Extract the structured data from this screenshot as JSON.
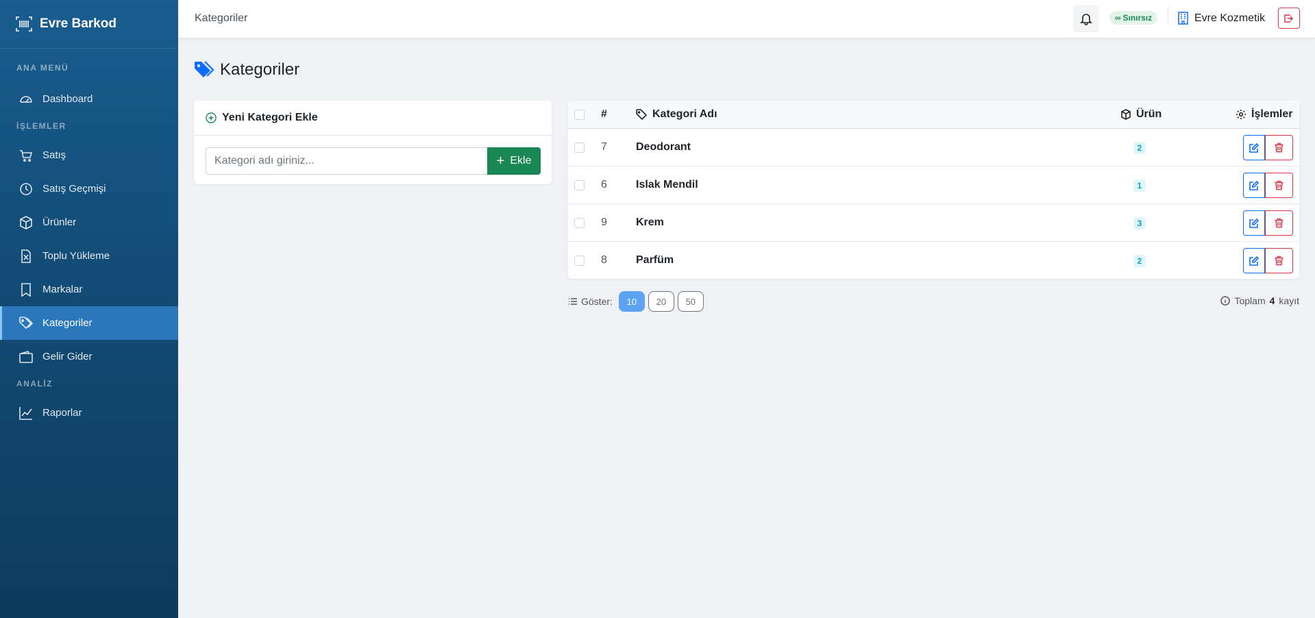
{
  "app": {
    "name": "Evre Barkod"
  },
  "sidebar": {
    "sections": [
      {
        "title": "ANA MENÜ"
      },
      {
        "title": "İŞLEMLER"
      },
      {
        "title": "ANALİZ"
      }
    ],
    "items": [
      {
        "label": "Dashboard",
        "icon": "speedometer-icon"
      },
      {
        "label": "Satış",
        "icon": "cart-icon"
      },
      {
        "label": "Satış Geçmişi",
        "icon": "clock-icon"
      },
      {
        "label": "Ürünler",
        "icon": "box-icon"
      },
      {
        "label": "Toplu Yükleme",
        "icon": "excel-file-icon"
      },
      {
        "label": "Markalar",
        "icon": "bookmark-icon"
      },
      {
        "label": "Kategoriler",
        "icon": "tags-icon",
        "active": true
      },
      {
        "label": "Gelir Gider",
        "icon": "wallet-icon"
      },
      {
        "label": "Raporlar",
        "icon": "chart-line-icon"
      }
    ]
  },
  "topbar": {
    "breadcrumb": "Kategoriler",
    "plan_badge": "Sınırsız",
    "company": "Evre Kozmetik"
  },
  "page": {
    "title": "Kategoriler"
  },
  "add_form": {
    "title": "Yeni Kategori Ekle",
    "input_placeholder": "Kategori adı giriniz...",
    "input_value": "",
    "button_label": "Ekle"
  },
  "table": {
    "columns": {
      "num": "#",
      "name": "Kategori Adı",
      "count": "Ürün",
      "actions": "İşlemler"
    },
    "rows": [
      {
        "id": "7",
        "name": "Deodorant",
        "count": "2"
      },
      {
        "id": "6",
        "name": "Islak Mendil",
        "count": "1"
      },
      {
        "id": "9",
        "name": "Krem",
        "count": "3"
      },
      {
        "id": "8",
        "name": "Parfüm",
        "count": "2"
      }
    ]
  },
  "pagination": {
    "show_label": "Göster:",
    "sizes": [
      "10",
      "20",
      "50"
    ],
    "selected": "10",
    "total_prefix": "Toplam",
    "total_count": "4",
    "total_suffix": "kayıt"
  },
  "colors": {
    "sidebar": "#134d78",
    "active_item": "#2a78bb",
    "primary": "#0d6efd",
    "success": "#198754",
    "danger": "#dc3545",
    "info": "#0aa2c0"
  }
}
